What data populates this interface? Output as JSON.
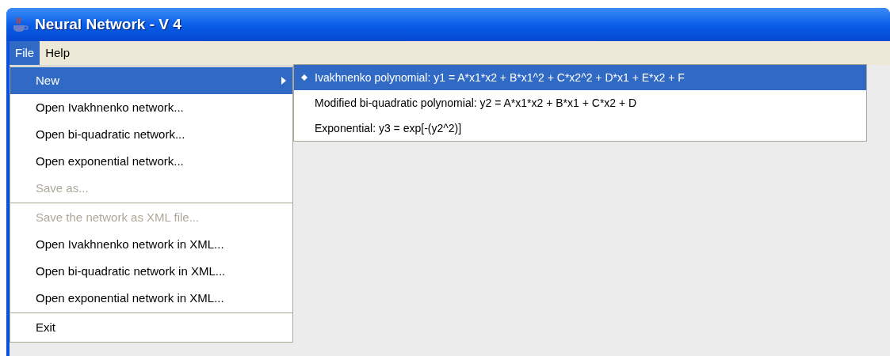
{
  "window": {
    "title": "Neural Network - V 4"
  },
  "menubar": [
    {
      "label": "File",
      "selected": true
    },
    {
      "label": "Help",
      "selected": false
    }
  ],
  "file_menu": [
    {
      "kind": "item",
      "label": "New",
      "selected": true,
      "disabled": false,
      "submenu": true
    },
    {
      "kind": "item",
      "label": "Open Ivakhnenko network...",
      "selected": false,
      "disabled": false,
      "submenu": false
    },
    {
      "kind": "item",
      "label": "Open bi-quadratic network...",
      "selected": false,
      "disabled": false,
      "submenu": false
    },
    {
      "kind": "item",
      "label": "Open exponential network...",
      "selected": false,
      "disabled": false,
      "submenu": false
    },
    {
      "kind": "item",
      "label": "Save as...",
      "selected": false,
      "disabled": true,
      "submenu": false
    },
    {
      "kind": "separator"
    },
    {
      "kind": "item",
      "label": "Save the network as XML file...",
      "selected": false,
      "disabled": true,
      "submenu": false
    },
    {
      "kind": "item",
      "label": "Open Ivakhnenko network in XML...",
      "selected": false,
      "disabled": false,
      "submenu": false
    },
    {
      "kind": "item",
      "label": "Open bi-quadratic network in XML...",
      "selected": false,
      "disabled": false,
      "submenu": false
    },
    {
      "kind": "item",
      "label": "Open exponential network in XML...",
      "selected": false,
      "disabled": false,
      "submenu": false
    },
    {
      "kind": "separator"
    },
    {
      "kind": "item",
      "label": "Exit",
      "selected": false,
      "disabled": false,
      "submenu": false
    }
  ],
  "new_submenu": [
    {
      "label": "Ivakhnenko polynomial: y1 = A*x1*x2 + B*x1^2 + C*x2^2 + D*x1 + E*x2 + F",
      "selected": true,
      "checked": true
    },
    {
      "label": "Modified bi-quadratic polynomial: y2 = A*x1*x2 + B*x1 + C*x2 + D",
      "selected": false,
      "checked": false
    },
    {
      "label": "Exponential: y3 = exp[-(y2^2)]",
      "selected": false,
      "checked": false
    }
  ]
}
